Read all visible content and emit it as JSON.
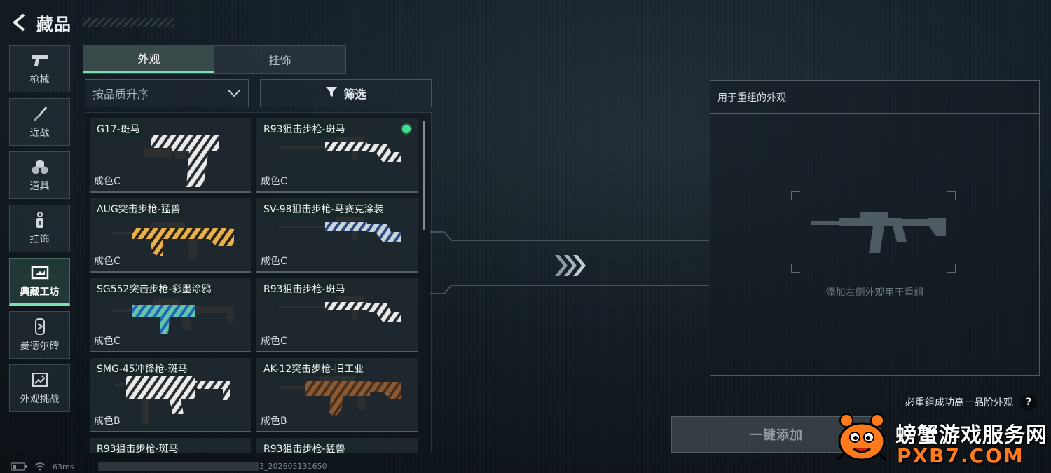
{
  "header": {
    "title": "藏品"
  },
  "side_nav": {
    "items": [
      {
        "label": "枪械",
        "icon": "pistol-icon",
        "active": false
      },
      {
        "label": "近战",
        "icon": "knife-icon",
        "active": false
      },
      {
        "label": "道具",
        "icon": "grenade-icon",
        "active": false
      },
      {
        "label": "挂饰",
        "icon": "charm-icon",
        "active": false
      },
      {
        "label": "典藏工坊",
        "icon": "workshop-icon",
        "active": true
      },
      {
        "label": "曼德尔砖",
        "icon": "brick-icon",
        "active": false
      },
      {
        "label": "外观挑战",
        "icon": "challenge-icon",
        "active": false
      }
    ]
  },
  "tabs": [
    {
      "label": "外观",
      "active": true
    },
    {
      "label": "挂饰",
      "active": false
    }
  ],
  "sort": {
    "label": "按品质升序"
  },
  "filter": {
    "label": "筛选"
  },
  "skins": [
    {
      "name": "G17-斑马",
      "grade": "成色C",
      "weapon": "pistol",
      "pattern": "zebra",
      "equipped": false
    },
    {
      "name": "R93狙击步枪-斑马",
      "grade": "成色C",
      "weapon": "sniper",
      "pattern": "zebra",
      "equipped": true
    },
    {
      "name": "AUG突击步枪-猛兽",
      "grade": "成色C",
      "weapon": "bullpup",
      "pattern": "beast",
      "equipped": false
    },
    {
      "name": "SV-98狙击步枪-马赛克涂装",
      "grade": "成色C",
      "weapon": "sniper",
      "pattern": "mosaic",
      "equipped": false
    },
    {
      "name": "SG552突击步枪-彩墨涂鸦",
      "grade": "成色C",
      "weapon": "rifle",
      "pattern": "graffiti",
      "equipped": false
    },
    {
      "name": "R93狙击步枪-斑马",
      "grade": "成色C",
      "weapon": "sniper",
      "pattern": "zebra",
      "equipped": false
    },
    {
      "name": "SMG-45冲锋枪-斑马",
      "grade": "成色B",
      "weapon": "smg",
      "pattern": "zebra",
      "equipped": false
    },
    {
      "name": "AK-12突击步枪-旧工业",
      "grade": "成色B",
      "weapon": "ak",
      "pattern": "rust",
      "equipped": false
    }
  ],
  "partial_skins": [
    {
      "name": "R93狙击步枪-斑马"
    },
    {
      "name": "R93狙击步枪-猛兽"
    }
  ],
  "recombine": {
    "title": "用于重组的外观",
    "empty_hint": "添加左侧外观用于重组",
    "guarantee": "必重组成功高一品阶外观",
    "help": "?",
    "add_button": "一键添加"
  },
  "status": {
    "ping": "63ms",
    "build_suffix": "3_202605131650"
  },
  "watermark": {
    "cn": "螃蟹游戏服务网",
    "en": "PXB7.COM"
  },
  "colors": {
    "accent": "#7be0b0",
    "equipped": "#3fe08a",
    "watermark_orange": "#ff7a1a"
  }
}
